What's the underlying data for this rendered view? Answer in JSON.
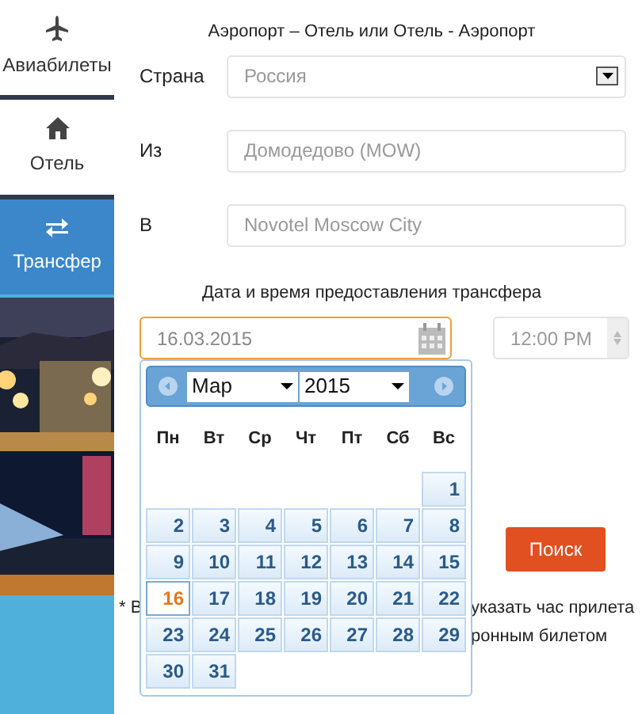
{
  "sidebar": {
    "items": [
      {
        "label": "Авиабилеты",
        "selected": false
      },
      {
        "label": "Отель",
        "selected": false
      },
      {
        "label": "Трансфер",
        "selected": true
      }
    ]
  },
  "form": {
    "title": "Аэропорт – Отель или Отель - Аэропорт",
    "fields": [
      {
        "label": "Страна",
        "kind": "select",
        "value": "Россия"
      },
      {
        "label": "Из",
        "kind": "text",
        "value": "Домодедово (MOW)"
      },
      {
        "label": "В",
        "kind": "text",
        "value": "Novotel Moscow City"
      }
    ],
    "datetime_title": "Дата и время предоставления трансфера",
    "date_field": {
      "value": "16.03.2015",
      "focused": true
    },
    "time_field": {
      "value": "12:00 PM"
    },
    "search_button": "Поиск",
    "footnote": {
      "start": "* В",
      "line_1_end": "указать час прилета",
      "line_2_end": "ронным билетом"
    }
  },
  "datepicker": {
    "month": "Мар",
    "year": "2015",
    "weekdays": [
      "Пн",
      "Вт",
      "Ср",
      "Чт",
      "Пт",
      "Сб",
      "Вс"
    ],
    "weeks": [
      {
        "kind": "first",
        "days": [
          {
            "day": "1",
            "selected": false
          }
        ]
      },
      {
        "kind": "full",
        "days": [
          {
            "day": "2",
            "selected": false
          },
          {
            "day": "3",
            "selected": false
          },
          {
            "day": "4",
            "selected": false
          },
          {
            "day": "5",
            "selected": false
          },
          {
            "day": "6",
            "selected": false
          },
          {
            "day": "7",
            "selected": false
          },
          {
            "day": "8",
            "selected": false
          }
        ]
      },
      {
        "kind": "full",
        "days": [
          {
            "day": "9",
            "selected": false
          },
          {
            "day": "10",
            "selected": false
          },
          {
            "day": "11",
            "selected": false
          },
          {
            "day": "12",
            "selected": false
          },
          {
            "day": "13",
            "selected": false
          },
          {
            "day": "14",
            "selected": false
          },
          {
            "day": "15",
            "selected": false
          }
        ]
      },
      {
        "kind": "full",
        "days": [
          {
            "day": "16",
            "selected": true
          },
          {
            "day": "17",
            "selected": false
          },
          {
            "day": "18",
            "selected": false
          },
          {
            "day": "19",
            "selected": false
          },
          {
            "day": "20",
            "selected": false
          },
          {
            "day": "21",
            "selected": false
          },
          {
            "day": "22",
            "selected": false
          }
        ]
      },
      {
        "kind": "full",
        "days": [
          {
            "day": "23",
            "selected": false
          },
          {
            "day": "24",
            "selected": false
          },
          {
            "day": "25",
            "selected": false
          },
          {
            "day": "26",
            "selected": false
          },
          {
            "day": "27",
            "selected": false
          },
          {
            "day": "28",
            "selected": false
          },
          {
            "day": "29",
            "selected": false
          }
        ]
      },
      {
        "kind": "last",
        "days": [
          {
            "day": "30",
            "selected": false
          },
          {
            "day": "31",
            "selected": false
          }
        ]
      }
    ]
  }
}
